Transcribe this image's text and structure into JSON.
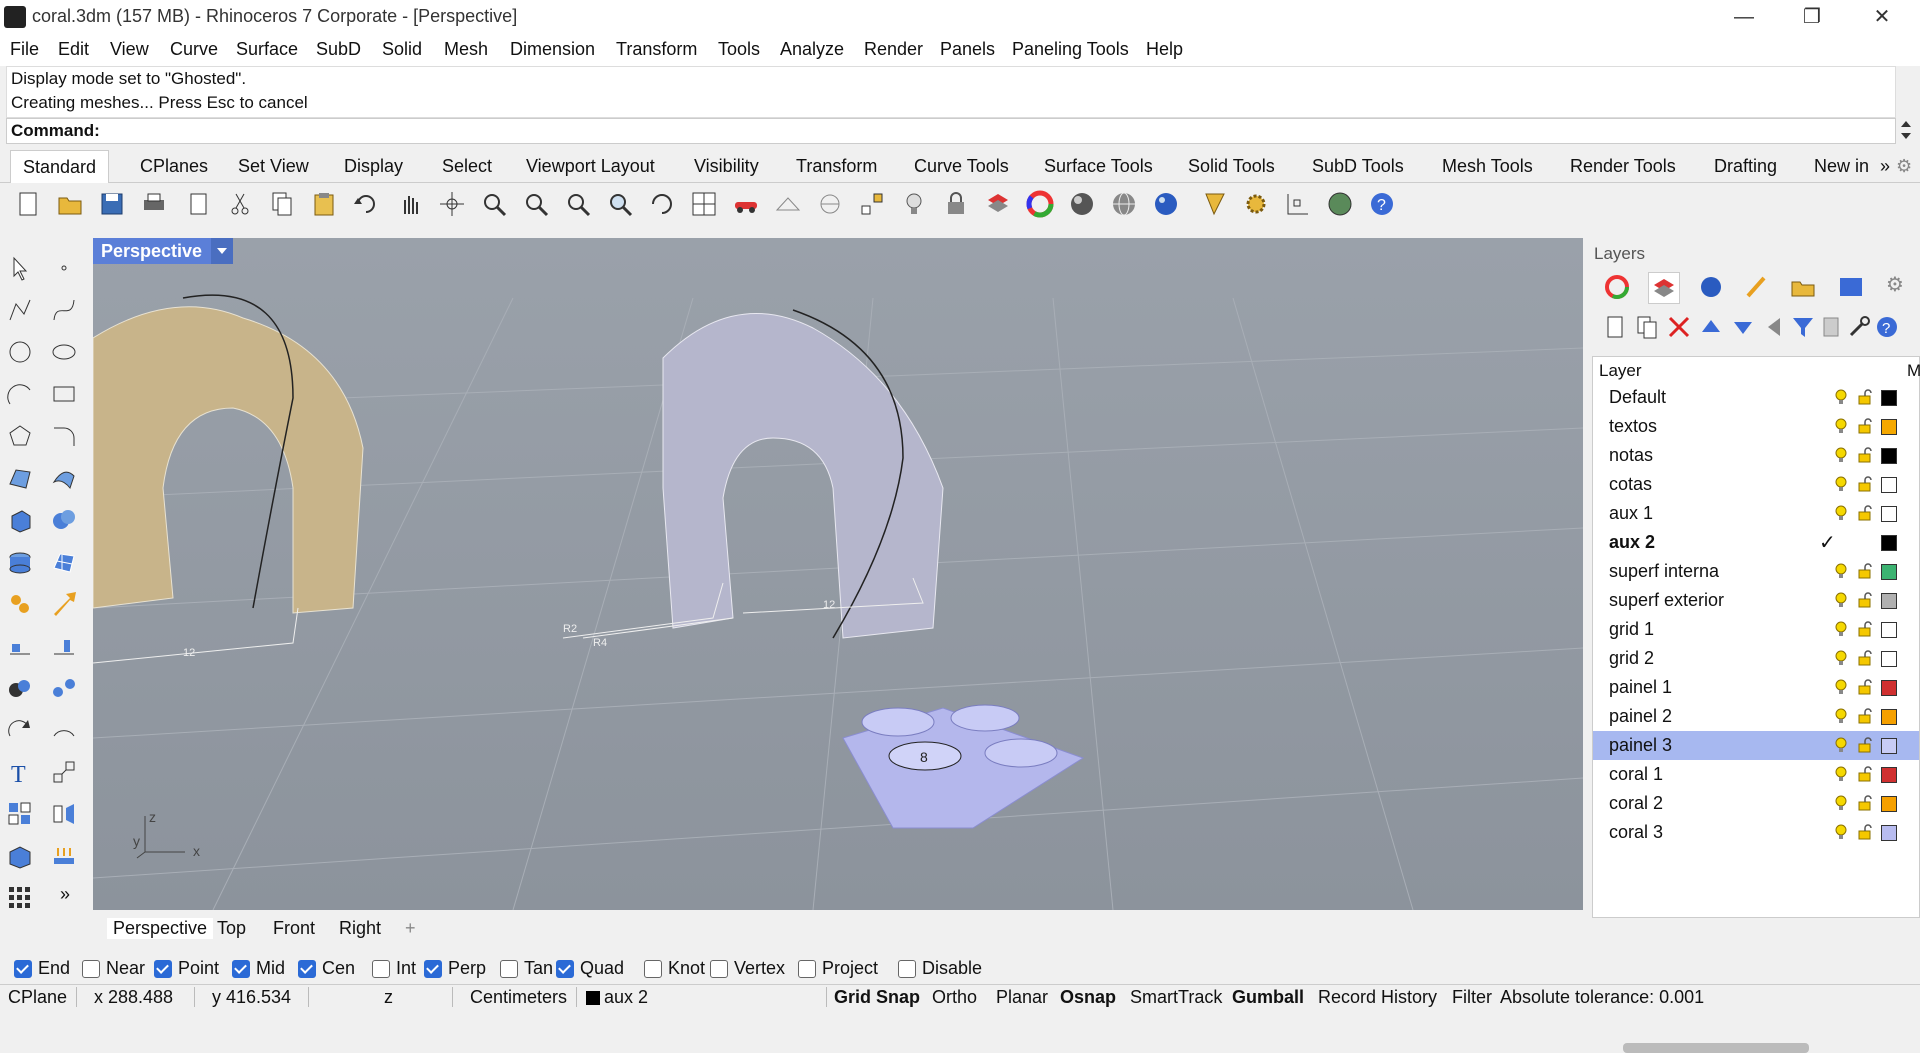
{
  "window": {
    "title": "coral.3dm (157 MB) - Rhinoceros 7 Corporate - [Perspective]",
    "minimize": "—",
    "restore": "❐",
    "close": "✕"
  },
  "menu": [
    "File",
    "Edit",
    "View",
    "Curve",
    "Surface",
    "SubD",
    "Solid",
    "Mesh",
    "Dimension",
    "Transform",
    "Tools",
    "Analyze",
    "Render",
    "Panels",
    "Paneling Tools",
    "Help"
  ],
  "command": {
    "history": [
      "Display mode set to \"Ghosted\".",
      "Creating meshes... Press Esc to cancel"
    ],
    "prompt": "Command:"
  },
  "toolbar_tabs": [
    "Standard",
    "CPlanes",
    "Set View",
    "Display",
    "Select",
    "Viewport Layout",
    "Visibility",
    "Transform",
    "Curve Tools",
    "Surface Tools",
    "Solid Tools",
    "SubD Tools",
    "Mesh Tools",
    "Render Tools",
    "Drafting",
    "New in"
  ],
  "toolbar_more": "»",
  "viewport": {
    "name": "Perspective",
    "axis_labels": {
      "z": "z",
      "y": "y",
      "x": "x"
    },
    "dims": {
      "r2": "R2",
      "r4": "R4",
      "d12a": "12",
      "d12b": "12",
      "label8": "8"
    }
  },
  "viewport_tabs": [
    "Perspective",
    "Top",
    "Front",
    "Right"
  ],
  "viewport_add": "+",
  "toolbox_more": "»",
  "osnaps": [
    {
      "label": "End",
      "checked": true
    },
    {
      "label": "Near",
      "checked": false
    },
    {
      "label": "Point",
      "checked": true
    },
    {
      "label": "Mid",
      "checked": true
    },
    {
      "label": "Cen",
      "checked": true
    },
    {
      "label": "Int",
      "checked": false
    },
    {
      "label": "Perp",
      "checked": true
    },
    {
      "label": "Tan",
      "checked": false
    },
    {
      "label": "Quad",
      "checked": true
    },
    {
      "label": "Knot",
      "checked": false
    },
    {
      "label": "Vertex",
      "checked": false
    },
    {
      "label": "Project",
      "checked": false
    },
    {
      "label": "Disable",
      "checked": false
    }
  ],
  "status": {
    "cplane": "CPlane",
    "x": "x 288.488",
    "y": "y 416.534",
    "z": "z",
    "units": "Centimeters",
    "layer": "aux 2",
    "grid_snap": "Grid Snap",
    "ortho": "Ortho",
    "planar": "Planar",
    "osnap": "Osnap",
    "smarttrack": "SmartTrack",
    "gumball": "Gumball",
    "record_history": "Record History",
    "filter": "Filter",
    "tolerance": "Absolute tolerance: 0.001"
  },
  "layers": {
    "panel_title": "Layers",
    "column_header": "Layer",
    "column_m": "M",
    "current_mark": "✓",
    "rows": [
      {
        "name": "Default",
        "color": "#000000"
      },
      {
        "name": "textos",
        "color": "#f5a800"
      },
      {
        "name": "notas",
        "color": "#000000"
      },
      {
        "name": "cotas",
        "color": "#ffffff"
      },
      {
        "name": "aux 1",
        "color": "#ffffff"
      },
      {
        "name": "aux 2",
        "color": "#000000"
      },
      {
        "name": "superf interna",
        "color": "#3cb371"
      },
      {
        "name": "superf exterior",
        "color": "#b0b0b0"
      },
      {
        "name": "grid 1",
        "color": "#ffffff"
      },
      {
        "name": "grid 2",
        "color": "#ffffff"
      },
      {
        "name": "painel 1",
        "color": "#d03030"
      },
      {
        "name": "painel 2",
        "color": "#f5a000"
      },
      {
        "name": "painel 3",
        "color": "#c8ccf5"
      },
      {
        "name": "coral 1",
        "color": "#d03030"
      },
      {
        "name": "coral 2",
        "color": "#f5a000"
      },
      {
        "name": "coral 3",
        "color": "#b8bcf0"
      }
    ],
    "current_layer": "aux 2",
    "selected_layer": "painel 3"
  },
  "icons": {
    "toolbar": [
      "new-file-icon",
      "open-icon",
      "save-icon",
      "print-icon",
      "import-icon",
      "cut-icon",
      "copy-icon",
      "paste-icon",
      "undo-icon",
      "pan-icon",
      "rotate-view-icon",
      "zoom-icon",
      "zoom-window-icon",
      "zoom-extents-icon",
      "zoom-selected-icon",
      "rotate-icon",
      "viewport-layout-icon",
      "car-icon",
      "grid-icon",
      "measure-icon",
      "snap-icon",
      "light-icon",
      "lock-icon",
      "layer-icon",
      "color-wheel-icon",
      "shaded-sphere-icon",
      "wire-sphere-icon",
      "render-sphere-icon",
      "render-preview-icon",
      "gear-icon",
      "dim-icon",
      "globe-icon",
      "help-icon"
    ]
  }
}
